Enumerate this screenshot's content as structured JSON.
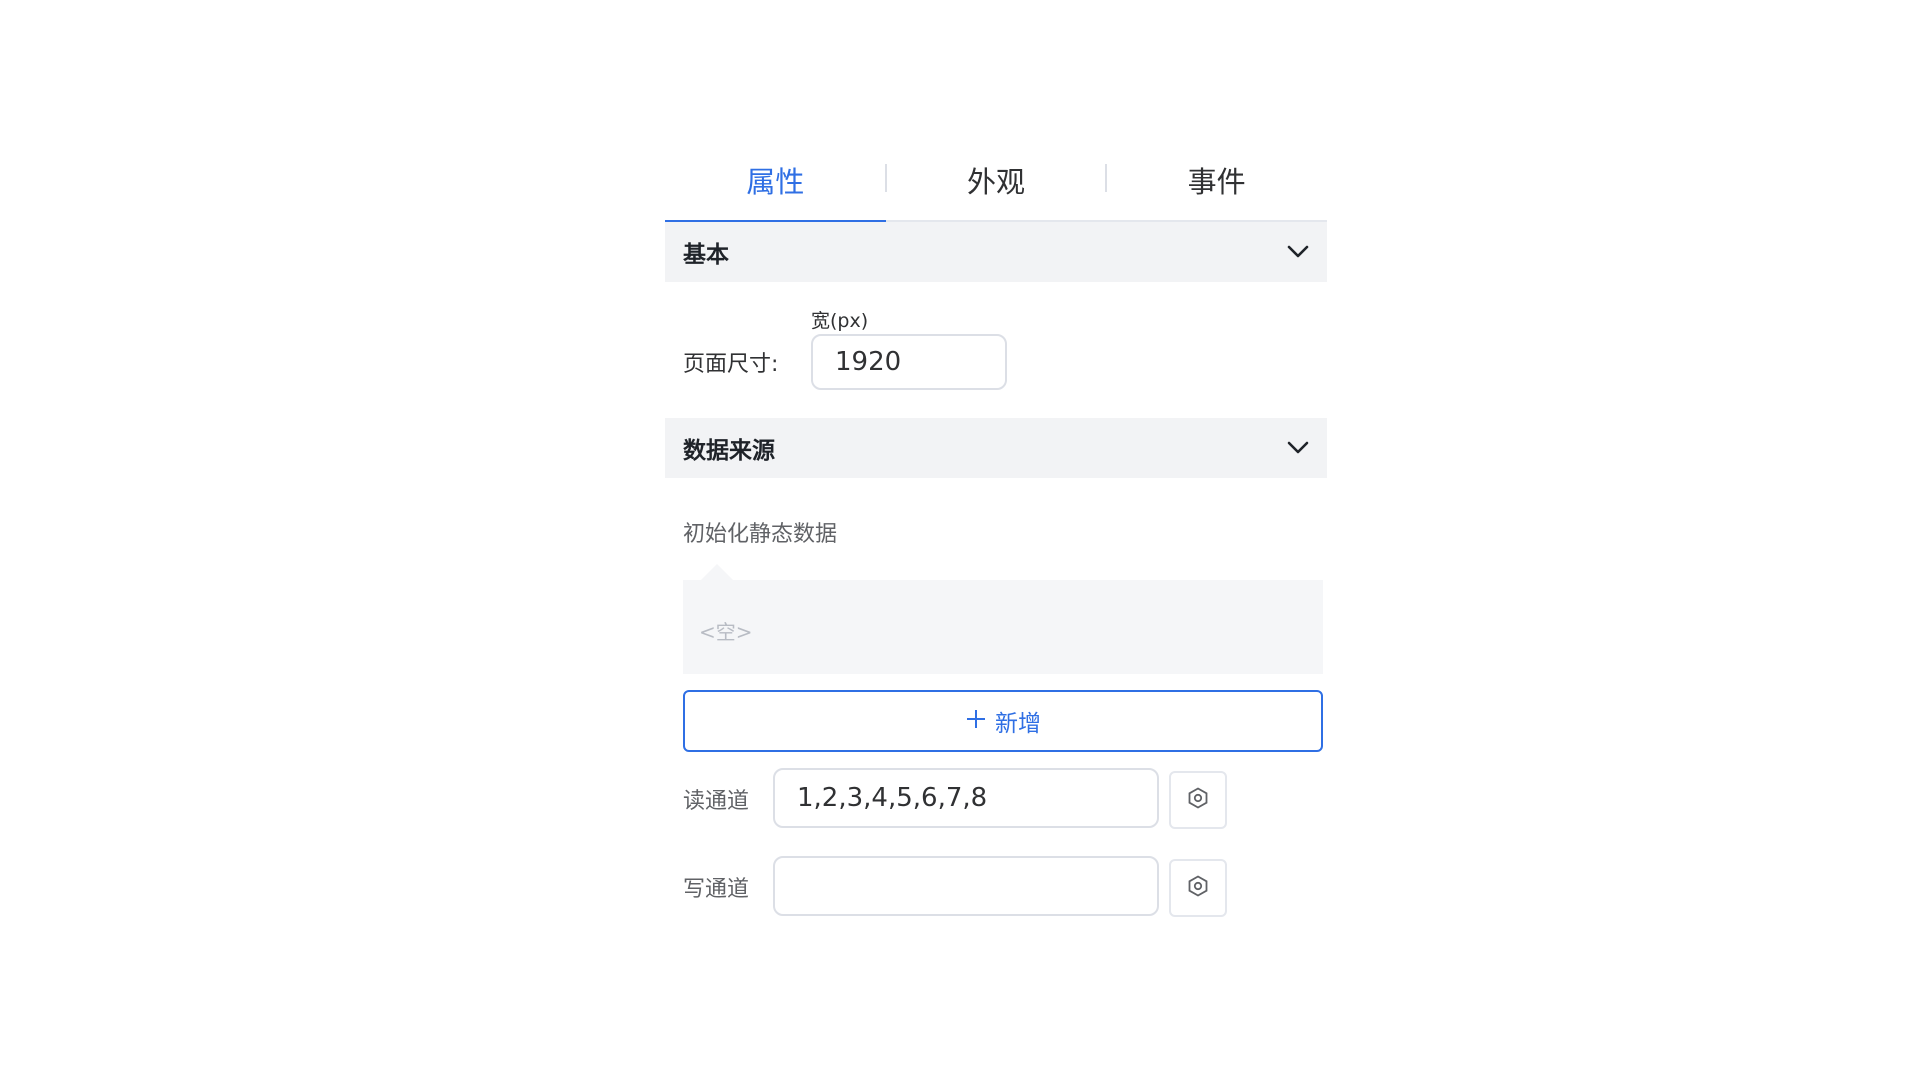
{
  "tabs": [
    {
      "label": "属性",
      "active": true
    },
    {
      "label": "外观",
      "active": false
    },
    {
      "label": "事件",
      "active": false
    }
  ],
  "basic": {
    "title": "基本",
    "chevron_icon": "chevron-down-icon",
    "page_size_label": "页面尺寸:",
    "width_caption": "宽(px)",
    "width_value": "1920"
  },
  "datasource": {
    "title": "数据来源",
    "chevron_icon": "chevron-down-icon",
    "init_label": "初始化静态数据",
    "empty_text": "<空>",
    "add_button": {
      "icon": "plus-icon",
      "label": "新增"
    },
    "read_channel": {
      "label": "读通道",
      "value": "1,2,3,4,5,6,7,8",
      "icon": "settings-icon"
    },
    "write_channel": {
      "label": "写通道",
      "value": "",
      "icon": "settings-icon"
    }
  },
  "colors": {
    "accent": "#2f6fe4",
    "section_bg": "#f2f3f5",
    "border": "#dcdfe6"
  }
}
